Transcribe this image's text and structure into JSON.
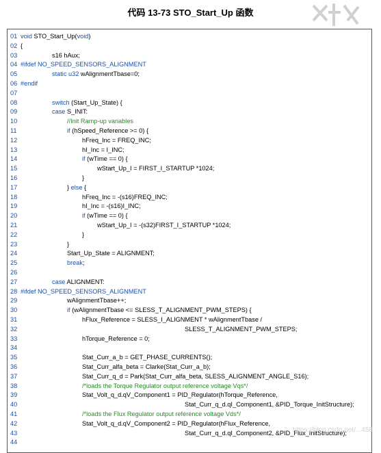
{
  "title": "代码  13-73 STO_Start_Up 函数",
  "watermark": "https://blog.csdn.net/...458",
  "code_lines": [
    {
      "n": "01",
      "t": "void STO_Start_Up(void)",
      "k": "mix"
    },
    {
      "n": "02",
      "t": "{",
      "k": "plain"
    },
    {
      "n": "03",
      "t": "s16 hAux;",
      "k": "plain"
    },
    {
      "n": "04",
      "t": "#ifdef NO_SPEED_SENSORS_ALIGNMENT",
      "k": "pp"
    },
    {
      "n": "05",
      "t": "static u32 wAlignmentTbase=0;",
      "k": "mix2"
    },
    {
      "n": "06",
      "t": "#endif",
      "k": "pp"
    },
    {
      "n": "07",
      "t": "",
      "k": "plain"
    },
    {
      "n": "08",
      "t": "switch (Start_Up_State) {",
      "k": "sw"
    },
    {
      "n": "09",
      "t": "case S_INIT:",
      "k": "case"
    },
    {
      "n": "10",
      "t": "//Init Ramp-up variables",
      "k": "cm"
    },
    {
      "n": "11",
      "t": "if (hSpeed_Reference >= 0) {",
      "k": "if"
    },
    {
      "n": "12",
      "t": "hFreq_Inc = FREQ_INC;",
      "k": "plain"
    },
    {
      "n": "13",
      "t": "hI_Inc = I_INC;",
      "k": "plain"
    },
    {
      "n": "14",
      "t": "if (wTime == 0) {",
      "k": "if"
    },
    {
      "n": "15",
      "t": "wStart_Up_I = FIRST_I_STARTUP *1024;",
      "k": "plain"
    },
    {
      "n": "16",
      "t": "}",
      "k": "plain"
    },
    {
      "n": "17",
      "t": "} else {",
      "k": "else"
    },
    {
      "n": "18",
      "t": "hFreq_Inc = -(s16)FREQ_INC;",
      "k": "plain"
    },
    {
      "n": "19",
      "t": "hI_Inc = -(s16)I_INC;",
      "k": "plain"
    },
    {
      "n": "20",
      "t": "if (wTime == 0) {",
      "k": "if"
    },
    {
      "n": "21",
      "t": "wStart_Up_I = -(s32)FIRST_I_STARTUP *1024;",
      "k": "plain"
    },
    {
      "n": "22",
      "t": "}",
      "k": "plain"
    },
    {
      "n": "23",
      "t": "}",
      "k": "plain"
    },
    {
      "n": "24",
      "t": "Start_Up_State = ALIGNMENT;",
      "k": "plain"
    },
    {
      "n": "25",
      "t": "break;",
      "k": "kwline"
    },
    {
      "n": "26",
      "t": "",
      "k": "plain"
    },
    {
      "n": "27",
      "t": "case ALIGNMENT:",
      "k": "case"
    },
    {
      "n": "28",
      "t": "#ifdef NO_SPEED_SENSORS_ALIGNMENT",
      "k": "pp"
    },
    {
      "n": "29",
      "t": "wAlignmentTbase++;",
      "k": "plain"
    },
    {
      "n": "30",
      "t": "if (wAlignmentTbase <= SLESS_T_ALIGNMENT_PWM_STEPS) {",
      "k": "if"
    },
    {
      "n": "31",
      "t": "hFlux_Reference = SLESS_I_ALIGNMENT * wAlignmentTbase /",
      "k": "plain"
    },
    {
      "n": "32",
      "t": "SLESS_T_ALIGNMENT_PWM_STEPS;",
      "k": "plain"
    },
    {
      "n": "33",
      "t": "hTorque_Reference = 0;",
      "k": "plain"
    },
    {
      "n": "34",
      "t": "",
      "k": "plain"
    },
    {
      "n": "35",
      "t": "Stat_Curr_a_b = GET_PHASE_CURRENTS();",
      "k": "plain"
    },
    {
      "n": "36",
      "t": "Stat_Curr_alfa_beta = Clarke(Stat_Curr_a_b);",
      "k": "plain"
    },
    {
      "n": "37",
      "t": "Stat_Curr_q_d = Park(Stat_Curr_alfa_beta, SLESS_ALIGNMENT_ANGLE_S16);",
      "k": "plain"
    },
    {
      "n": "38",
      "t": "/*loads the Torque Regulator output reference voltage Vqs*/",
      "k": "cm"
    },
    {
      "n": "39",
      "t": "Stat_Volt_q_d.qV_Component1 = PID_Regulator(hTorque_Reference,",
      "k": "plain"
    },
    {
      "n": "40",
      "t": "Stat_Curr_q_d.qI_Component1, &PID_Torque_InitStructure);",
      "k": "plain"
    },
    {
      "n": "41",
      "t": "/*loads the Flux Regulator output reference voltage Vds*/",
      "k": "cm"
    },
    {
      "n": "42",
      "t": "Stat_Volt_q_d.qV_Component2 = PID_Regulator(hFlux_Reference,",
      "k": "plain"
    },
    {
      "n": "43",
      "t": "Stat_Curr_q_d.qI_Component2, &PID_Flux_InitStructure);",
      "k": "plain"
    },
    {
      "n": "44",
      "t": "",
      "k": "plain"
    }
  ]
}
